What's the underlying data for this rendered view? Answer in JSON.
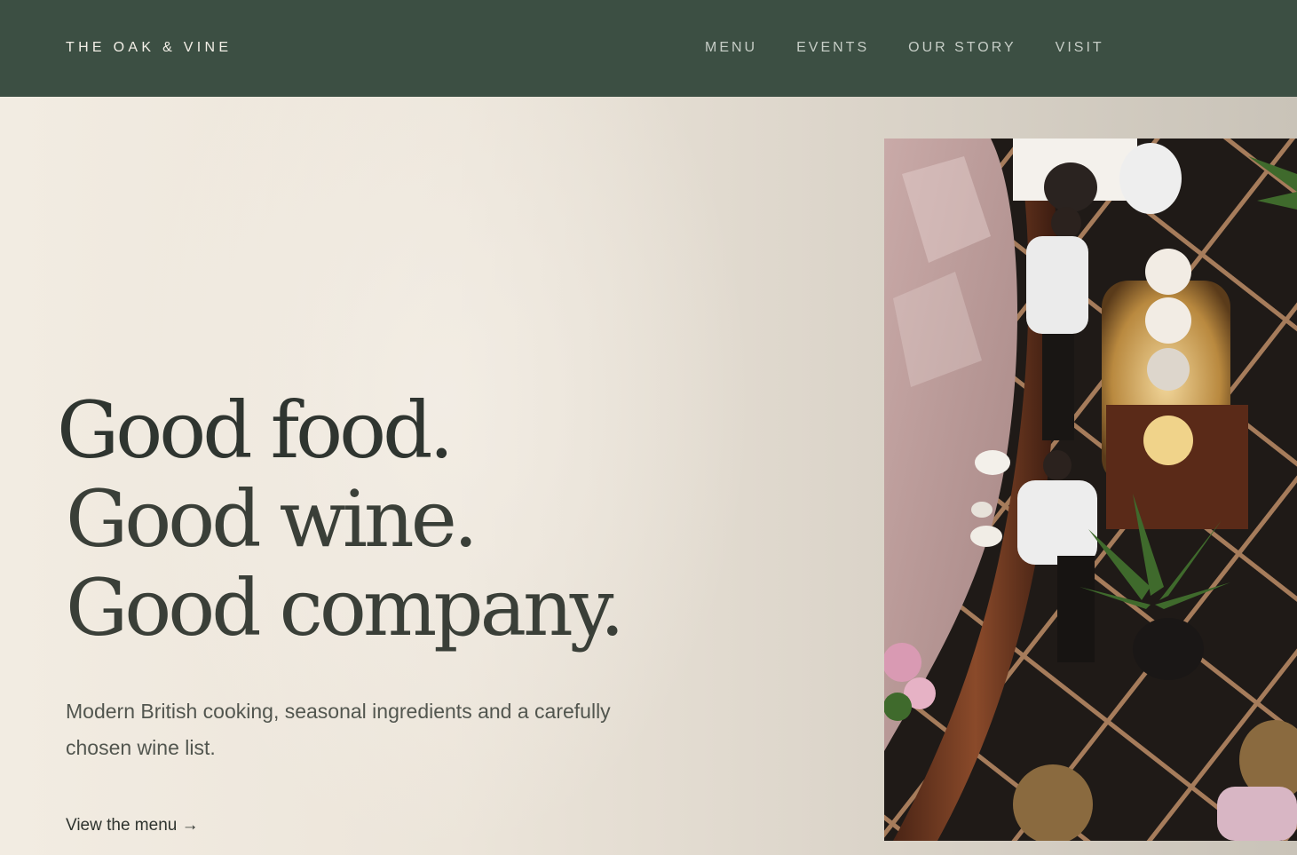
{
  "header": {
    "brand": "THE OAK & VINE",
    "nav": [
      "MENU",
      "EVENTS",
      "OUR STORY",
      "VISIT"
    ]
  },
  "hero": {
    "headline": [
      "Good food.",
      "Good wine.",
      "Good company."
    ],
    "subtitle": "Modern British cooking, seasonal ingredients and a carefully chosen wine list.",
    "cta": "View the menu →"
  },
  "colors": {
    "header_bg": "#3c4f43",
    "hero_bg": "#ece5da",
    "headline": "#2f3530",
    "body_text": "#52564f"
  }
}
